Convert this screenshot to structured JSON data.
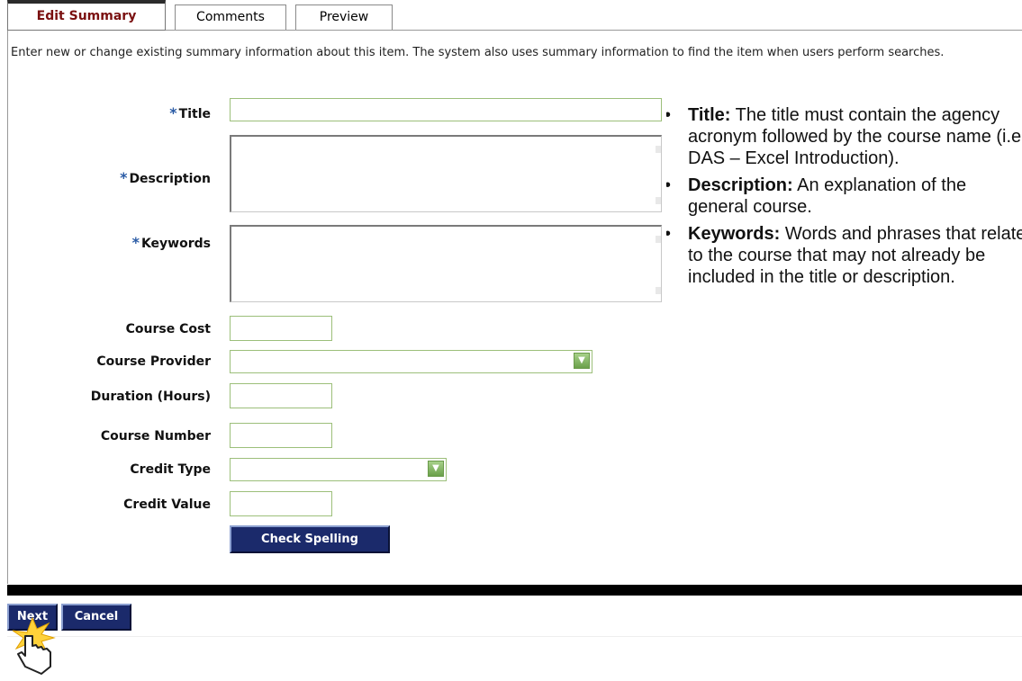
{
  "tabs": [
    {
      "label": "Edit Summary",
      "active": true
    },
    {
      "label": "Comments",
      "active": false
    },
    {
      "label": "Preview",
      "active": false
    }
  ],
  "intro": "Enter new or change existing summary information about this item. The system also uses summary information to find the item when users perform searches.",
  "form": {
    "required_mark": "*",
    "title_label": "Title",
    "title_value": "",
    "description_label": "Description",
    "description_value": "",
    "keywords_label": "Keywords",
    "keywords_value": "",
    "course_cost_label": "Course Cost",
    "course_cost_value": "",
    "course_provider_label": "Course Provider",
    "course_provider_value": "",
    "duration_label": "Duration (Hours)",
    "duration_value": "",
    "course_number_label": "Course Number",
    "course_number_value": "",
    "credit_type_label": "Credit Type",
    "credit_type_value": "",
    "credit_value_label": "Credit Value",
    "credit_value_value": "",
    "check_spelling_label": "Check Spelling"
  },
  "notes": [
    {
      "term": "Title:",
      "text": "The title must contain the agency acronym followed by the course name (i.e. DAS – Excel Introduction)."
    },
    {
      "term": "Description:",
      "text": "An explanation of the general course."
    },
    {
      "term": "Keywords:",
      "text": "Words and phrases that relate to the course that may not already be included in the title or description."
    }
  ],
  "bullet": "•",
  "footer": {
    "next_label": "Next",
    "cancel_label": "Cancel"
  },
  "icons": {
    "cursor": "hand-pointer-icon",
    "select": "chevron-down-icon"
  },
  "colors": {
    "active_tab_text": "#7a1010",
    "required": "#2a5ba5",
    "button_bg": "#1b2a6b",
    "field_border": "#9cbf7a"
  }
}
